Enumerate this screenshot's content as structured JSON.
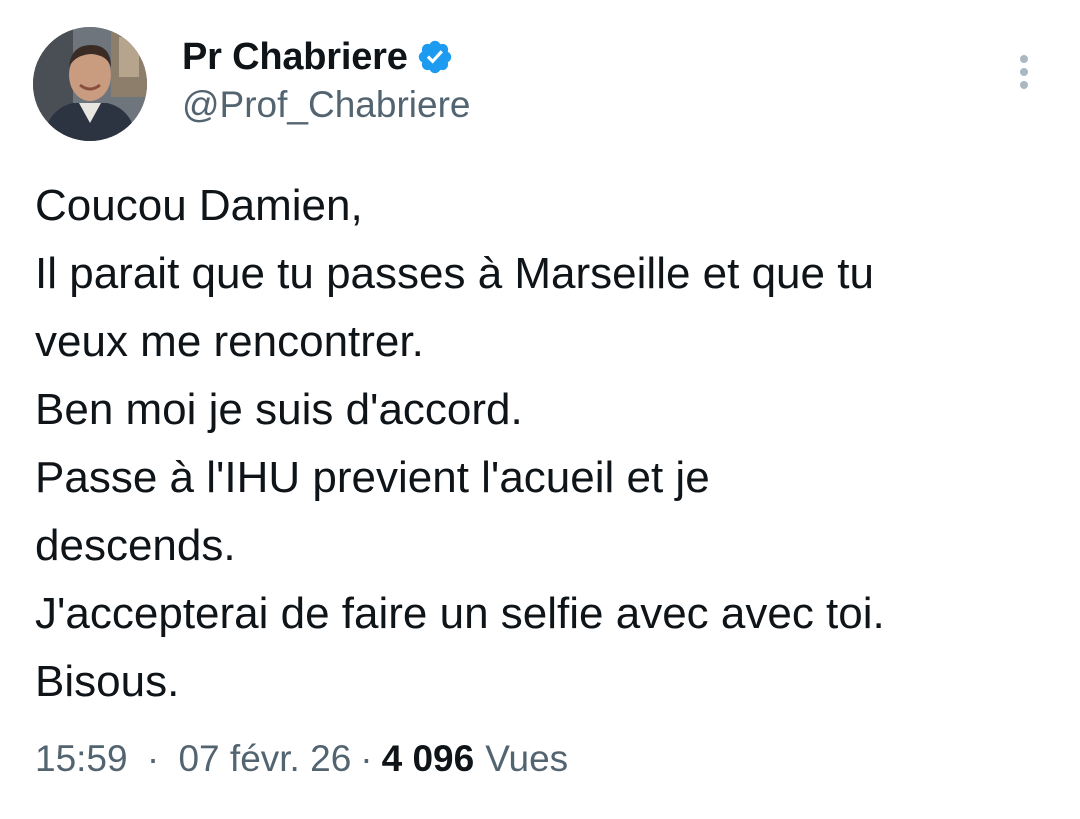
{
  "author": {
    "display_name": "Pr Chabriere",
    "handle": "@Prof_Chabriere",
    "verified": true,
    "avatar_icon": "profile-photo",
    "verified_color": "#1d9bf0"
  },
  "more_menu": {
    "icon": "more-vertical-icon"
  },
  "tweet": {
    "lines": [
      "Coucou Damien,",
      "Il parait que tu passes à Marseille et que tu",
      "veux me rencontrer.",
      "Ben moi je suis d'accord.",
      "Passe à l'IHU previent l'acueil et je",
      "descends.",
      "J'accepterai de faire un selfie avec avec toi.",
      "Bisous."
    ]
  },
  "meta": {
    "time": "15:59",
    "separator": "·",
    "date": "07 févr. 26",
    "views_count": "4 096",
    "views_label": "Vues"
  },
  "colors": {
    "text": "#0f1419",
    "secondary": "#536471",
    "accent": "#1d9bf0"
  }
}
